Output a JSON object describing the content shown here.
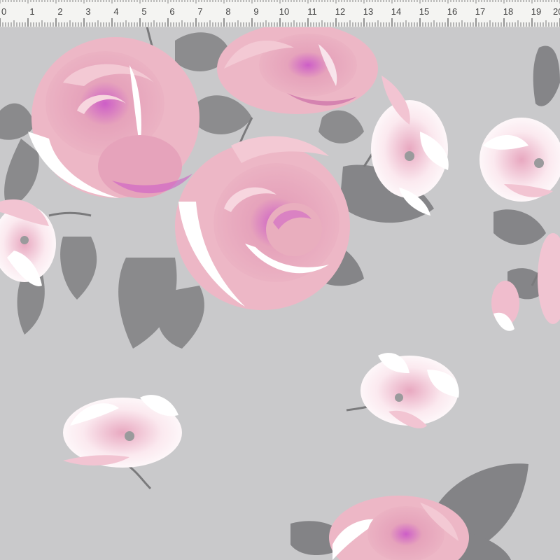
{
  "ruler": {
    "unit_labels": [
      "0",
      "1",
      "2",
      "3",
      "4",
      "5",
      "6",
      "7",
      "8",
      "9",
      "10",
      "11",
      "12",
      "13",
      "14",
      "15",
      "16",
      "17",
      "18",
      "19",
      "20"
    ]
  },
  "colors": {
    "ruler_bg": "#f4f4f2",
    "ruler_ink": "#555555",
    "fabric_bg": "#c9c9cb",
    "rose_pink": "#e9aebe",
    "rose_mid": "#dd93ae",
    "rose_deep": "#cd5ec7",
    "petal_white": "#ffffff",
    "leaf_grey": "#8c8c8e",
    "leaf_dark": "#6f6f72",
    "stem_grey": "#7a7a7c"
  },
  "print": {
    "motif": "rose-and-blossom-floral"
  }
}
